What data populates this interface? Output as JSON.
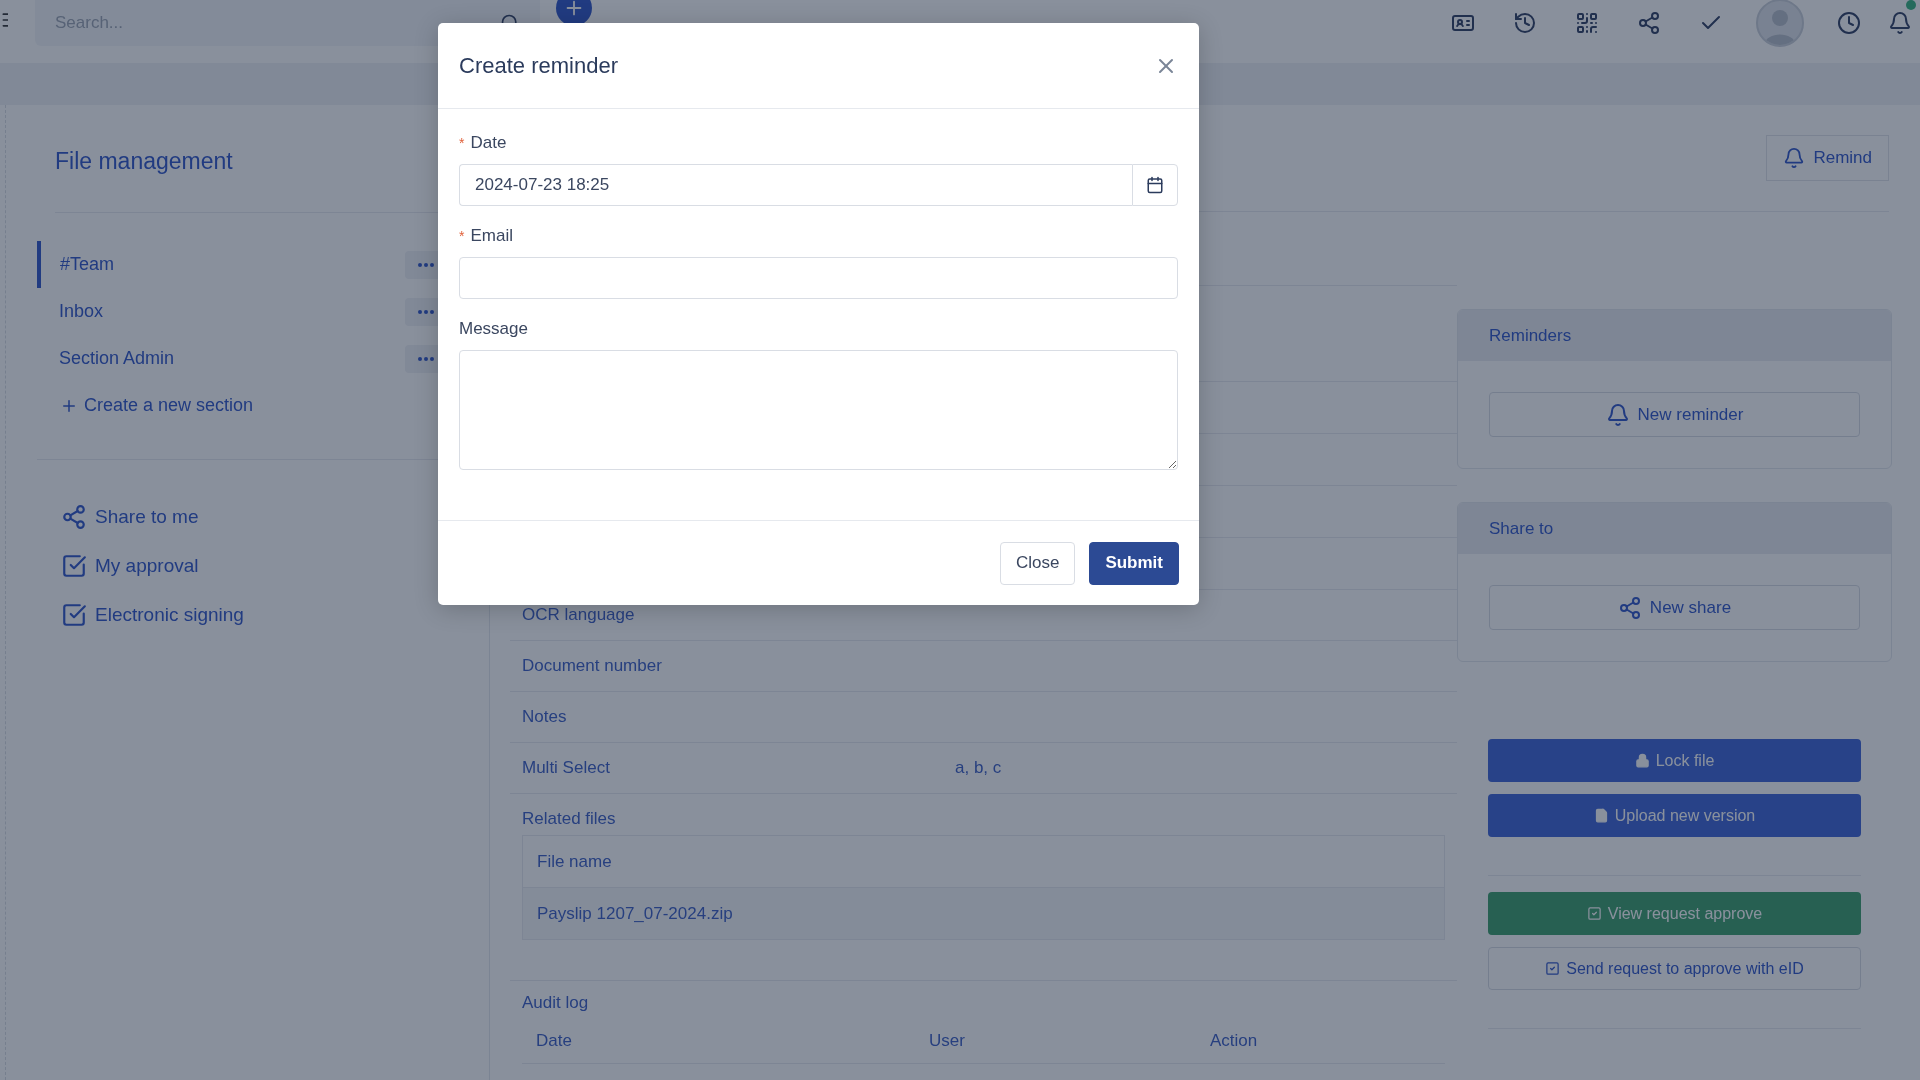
{
  "top_bar": {
    "search": {
      "placeholder": "Search..."
    }
  },
  "sidebar": {
    "title": "File management",
    "sections": [
      {
        "label": "#Team",
        "selected": true
      },
      {
        "label": "Inbox",
        "selected": false
      },
      {
        "label": "Section Admin",
        "selected": false
      }
    ],
    "create_label": "Create a new section",
    "links": [
      {
        "label": "Share to me",
        "kind": "share"
      },
      {
        "label": "My approval",
        "kind": "check"
      },
      {
        "label": "Electronic signing",
        "kind": "check"
      }
    ]
  },
  "details": {
    "remind_button": "Remind",
    "fields": [
      {
        "label": "OCR language"
      },
      {
        "label": "Document number"
      },
      {
        "label": "Notes"
      },
      {
        "label": "Multi Select",
        "value": "a, b, c"
      }
    ],
    "related_files": {
      "title": "Related files",
      "columns": [
        "File name"
      ],
      "rows": [
        [
          "Payslip 1207_07-2024.zip"
        ]
      ]
    },
    "audit_log": {
      "title": "Audit log",
      "columns": [
        "Date",
        "User",
        "Action"
      ]
    }
  },
  "right_panel": {
    "reminders": {
      "title": "Reminders",
      "button": "New reminder"
    },
    "share_to": {
      "title": "Share to",
      "button": "New share"
    },
    "actions": [
      {
        "label": "Lock file",
        "kind": "primary"
      },
      {
        "label": "Upload new version",
        "kind": "primary"
      },
      {
        "label": "View request approve",
        "kind": "success"
      },
      {
        "label": "Send request to approve with eID",
        "kind": "outline"
      }
    ]
  },
  "modal": {
    "title": "Create reminder",
    "required_mark": "*",
    "fields": [
      {
        "label": "Date",
        "required": true,
        "kind": "date",
        "value": "2024-07-23 18:25"
      },
      {
        "label": "Email",
        "required": true,
        "kind": "text"
      },
      {
        "label": "Message",
        "required": false,
        "kind": "textarea"
      }
    ],
    "buttons": [
      {
        "label": "Close",
        "kind": "secondary"
      },
      {
        "label": "Submit",
        "kind": "primary"
      }
    ]
  }
}
